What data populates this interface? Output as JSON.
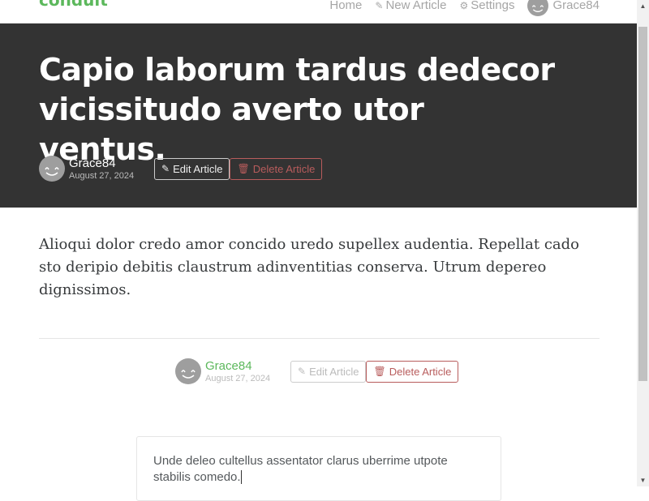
{
  "navbar": {
    "brand": "conduit",
    "links": {
      "home": "Home",
      "new_article": "New Article",
      "settings": "Settings",
      "profile": "Grace84"
    },
    "icons": {
      "new_article": "edit-icon",
      "settings": "gear-icon"
    }
  },
  "article": {
    "title": "Capio laborum tardus dedecor vicissitudo averto utor ventus.",
    "author": "Grace84",
    "date": "August 27, 2024",
    "body": "Alioqui dolor credo amor concido uredo supellex audentia. Repellat cado sto deripio debitis claustrum adinventitias conserva. Utrum depereo dignissimos."
  },
  "actions": {
    "edit_label": "Edit Article",
    "delete_label": "Delete Article",
    "edit_icon": "pencil-icon",
    "delete_icon": "trash-icon"
  },
  "comment": {
    "text": "Unde deleo cultellus assentator clarus uberrime utpote stabilis comedo."
  },
  "colors": {
    "brand": "#5cb85c",
    "banner": "#333333",
    "danger": "#b85c5c"
  }
}
